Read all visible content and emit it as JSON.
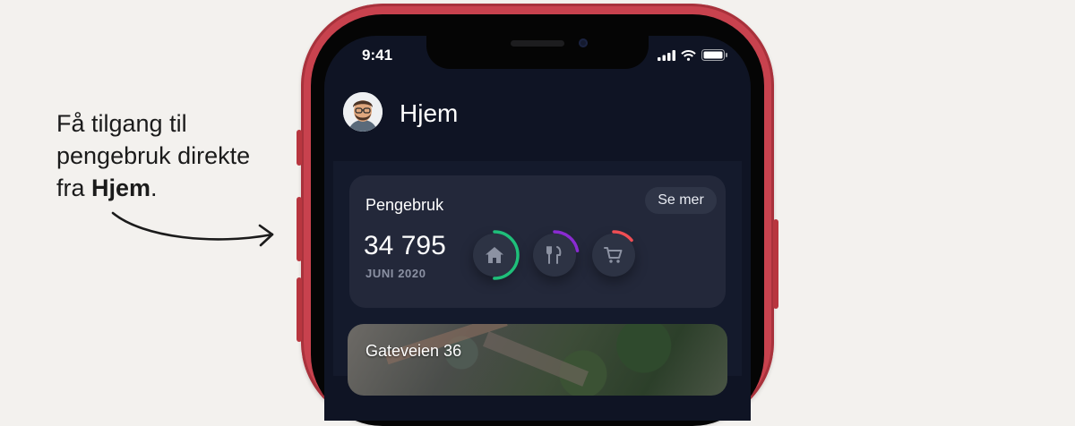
{
  "caption": {
    "line1": "Få tilgang til",
    "line2": "pengebruk direkte",
    "line3_prefix": "fra ",
    "line3_bold": "Hjem",
    "line3_suffix": "."
  },
  "status_bar": {
    "time": "9:41",
    "icons": [
      "signal-icon",
      "wifi-icon",
      "battery-icon"
    ]
  },
  "header": {
    "title": "Hjem",
    "avatar_icon": "avatar-memoji"
  },
  "spending_card": {
    "title": "Pengebruk",
    "see_more_label": "Se mer",
    "amount": "34 795",
    "period": "JUNI 2020",
    "categories": [
      {
        "icon": "home-icon",
        "ring_color": "#1fbf7a",
        "ring_fraction": 0.5
      },
      {
        "icon": "restaurant-icon",
        "ring_color": "#8a2bd1",
        "ring_fraction": 0.22
      },
      {
        "icon": "cart-icon",
        "ring_color": "#ef4e54",
        "ring_fraction": 0.14
      }
    ]
  },
  "property_card": {
    "title": "Gateveien 36"
  },
  "colors": {
    "background": "#f3f1ee",
    "phone_frame": "#c8424e",
    "screen": "#0f1424",
    "card": "#23283a"
  }
}
